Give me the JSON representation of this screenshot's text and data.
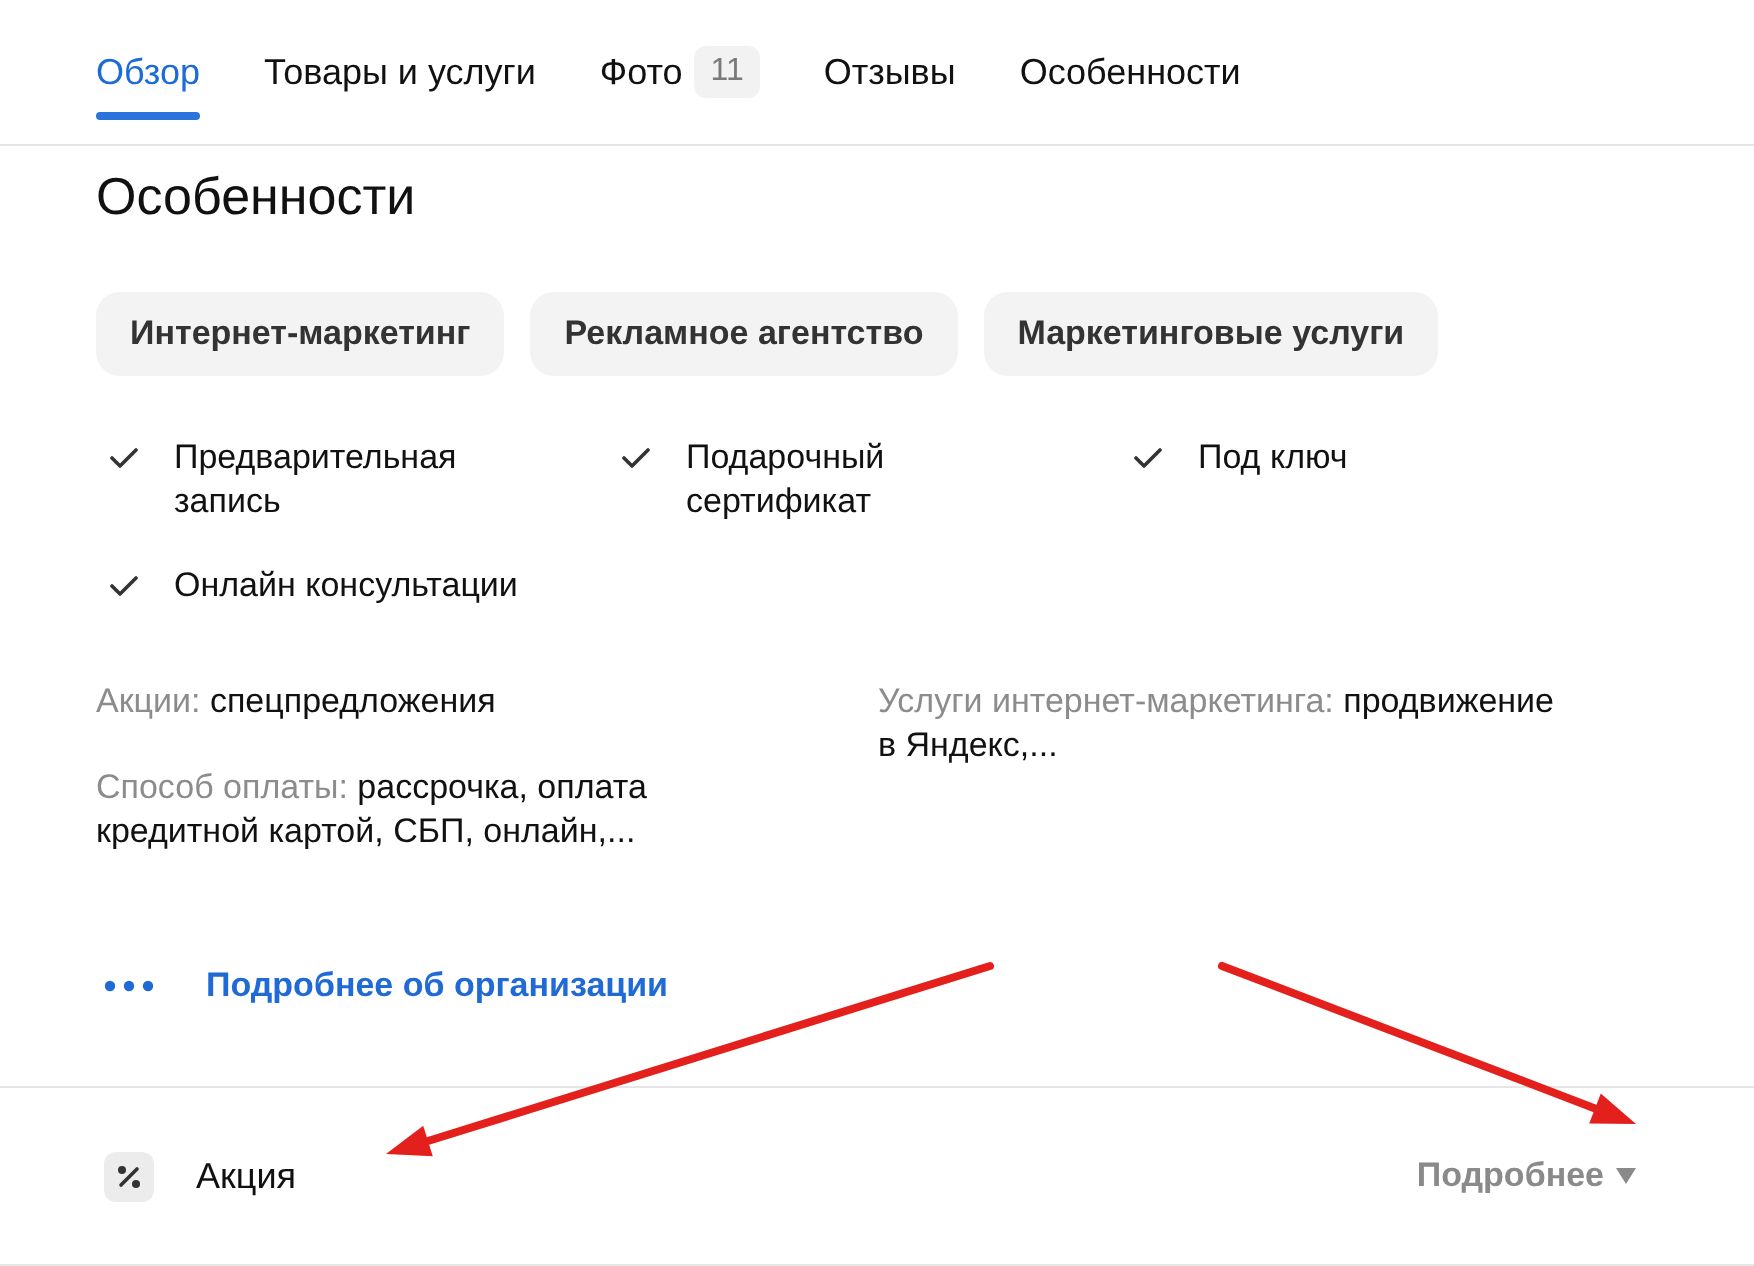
{
  "tabs": [
    {
      "label": "Обзор",
      "selected": true
    },
    {
      "label": "Товары и услуги",
      "selected": false
    },
    {
      "label": "Фото",
      "count": "11",
      "selected": false
    },
    {
      "label": "Отзывы",
      "selected": false
    },
    {
      "label": "Особенности",
      "selected": false
    }
  ],
  "section": {
    "title": "Особенности",
    "tags": [
      "Интернет-маркетинг",
      "Рекламное агентство",
      "Маркетинговые услуги"
    ],
    "features": [
      {
        "label": "Предварительная запись",
        "checked": true
      },
      {
        "label": "Подарочный сертификат",
        "checked": true
      },
      {
        "label": "Под ключ",
        "checked": true
      },
      {
        "label": "Онлайн консультации",
        "checked": true
      }
    ],
    "detail_columns": [
      [
        {
          "label": "Акции:",
          "value": "спецпредложения"
        },
        {
          "label": "Способ оплаты:",
          "value": "рассрочка, оплата кредитной картой, СБП, онлайн,..."
        }
      ],
      [
        {
          "label": "Услуги интернет-маркетинга:",
          "value": "продвижение в Яндекс,..."
        }
      ]
    ],
    "more_link": "Подробнее об организации"
  },
  "promo": {
    "label": "Акция",
    "action": "Подробнее"
  }
}
